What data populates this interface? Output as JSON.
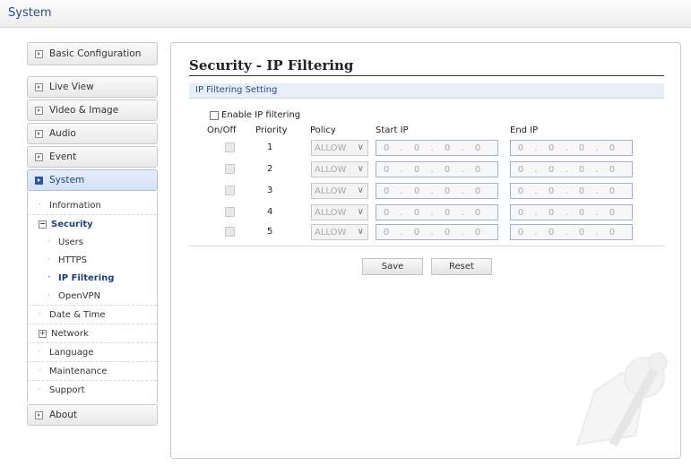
{
  "app_title": "System",
  "nav": {
    "basic_config": "Basic Configuration",
    "items": [
      "Live View",
      "Video & Image",
      "Audio",
      "Event",
      "System"
    ],
    "system_sub": {
      "information": "Information",
      "security": "Security",
      "security_sub": [
        "Users",
        "HTTPS",
        "IP Filtering",
        "OpenVPN"
      ],
      "others": [
        "Date & Time",
        "Network",
        "Language",
        "Maintenance",
        "Support"
      ]
    },
    "about": "About"
  },
  "page": {
    "title": "Security - IP Filtering",
    "section_title": "IP Filtering Setting",
    "enable_label": "Enable IP filtering",
    "headers": {
      "onoff": "On/Off",
      "priority": "Priority",
      "policy": "Policy",
      "start_ip": "Start IP",
      "end_ip": "End IP"
    },
    "rows": [
      {
        "priority": "1",
        "policy": "ALLOW",
        "start": [
          "0",
          "0",
          "0",
          "0"
        ],
        "end": [
          "0",
          "0",
          "0",
          "0"
        ]
      },
      {
        "priority": "2",
        "policy": "ALLOW",
        "start": [
          "0",
          "0",
          "0",
          "0"
        ],
        "end": [
          "0",
          "0",
          "0",
          "0"
        ]
      },
      {
        "priority": "3",
        "policy": "ALLOW",
        "start": [
          "0",
          "0",
          "0",
          "0"
        ],
        "end": [
          "0",
          "0",
          "0",
          "0"
        ]
      },
      {
        "priority": "4",
        "policy": "ALLOW",
        "start": [
          "0",
          "0",
          "0",
          "0"
        ],
        "end": [
          "0",
          "0",
          "0",
          "0"
        ]
      },
      {
        "priority": "5",
        "policy": "ALLOW",
        "start": [
          "0",
          "0",
          "0",
          "0"
        ],
        "end": [
          "0",
          "0",
          "0",
          "0"
        ]
      }
    ],
    "ip_separator": ".",
    "save_label": "Save",
    "reset_label": "Reset"
  },
  "colors": {
    "accent": "#2b4d8c",
    "active_nav": "#d4e0f4",
    "section_bg": "#e8eef8"
  }
}
